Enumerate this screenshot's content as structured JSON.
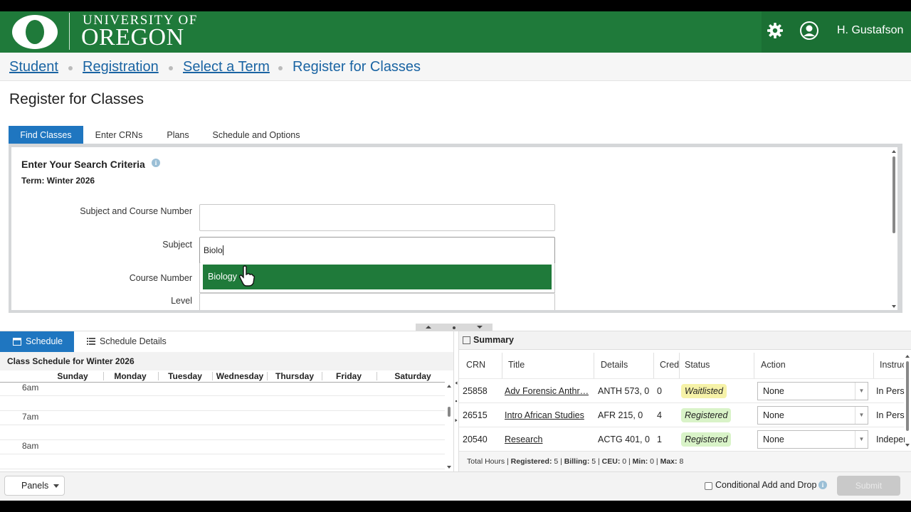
{
  "header": {
    "logo_small": "UNIVERSITY OF",
    "logo_big": "OREGON",
    "user_name": "H. Gustafson",
    "icons": {
      "settings": "gear-icon",
      "user": "user-circle-icon"
    }
  },
  "breadcrumb": {
    "items": [
      "Student",
      "Registration",
      "Select a Term",
      "Register for Classes"
    ]
  },
  "page_title": "Register for Classes",
  "tabs": [
    "Find Classes",
    "Enter CRNs",
    "Plans",
    "Schedule and Options"
  ],
  "search": {
    "title": "Enter Your Search Criteria",
    "info_glyph": "i",
    "term": "Term: Winter 2026",
    "labels": {
      "subject_course": "Subject and Course Number",
      "subject": "Subject",
      "course_number": "Course Number",
      "level": "Level"
    },
    "subject_course_value": "",
    "subject_value": "Biolo",
    "dropdown_option": "Biology"
  },
  "schedule": {
    "tab_schedule": "Schedule",
    "tab_details": "Schedule Details",
    "title": "Class Schedule for Winter 2026",
    "days": [
      "Sunday",
      "Monday",
      "Tuesday",
      "Wednesday",
      "Thursday",
      "Friday",
      "Saturday"
    ],
    "times": [
      "6am",
      "7am",
      "8am"
    ]
  },
  "summary": {
    "title": "Summary",
    "columns": [
      "CRN",
      "Title",
      "Details",
      "Cred",
      "Status",
      "Action",
      "Instruc"
    ],
    "rows": [
      {
        "crn": "25858",
        "title": "Adv Forensic Anthr…",
        "details": "ANTH 573, 0",
        "credits": "0",
        "status": "Waitlisted",
        "action": "None",
        "instruction": "In Perso"
      },
      {
        "crn": "26515",
        "title": "Intro African Studies",
        "details": "AFR 215, 0",
        "credits": "4",
        "status": "Registered",
        "action": "None",
        "instruction": "In Perso"
      },
      {
        "crn": "20540",
        "title": "Research",
        "details": "ACTG 401, 0",
        "credits": "1",
        "status": "Registered",
        "action": "None",
        "instruction": "Indepen"
      }
    ],
    "footer": {
      "total_hours": "Total Hours |",
      "registered_label": "Registered:",
      "registered": "5",
      "billing_label": "Billing:",
      "billing": "5",
      "ceu_label": "CEU:",
      "ceu": "0",
      "min_label": "Min:",
      "min": "0",
      "max_label": "Max:",
      "max": "8"
    }
  },
  "bottom": {
    "panels_label": "Panels",
    "conditional_label": "Conditional Add and Drop",
    "submit_label": "Submit"
  },
  "colors": {
    "brand_green": "#1f7a3a",
    "tab_blue": "#1f76c0",
    "link_blue": "#1a64a3",
    "waitlisted": "#f6f2a8",
    "registered": "#d9f3c8"
  }
}
